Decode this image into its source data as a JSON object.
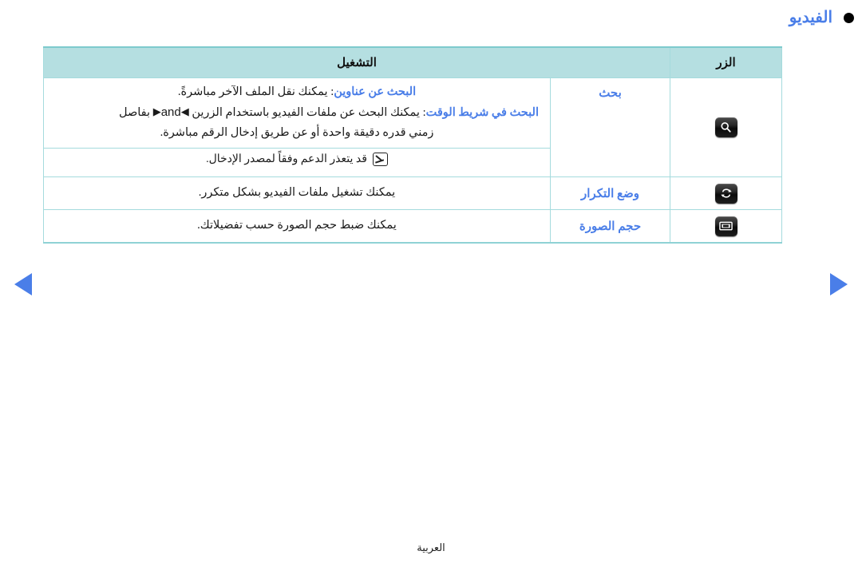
{
  "page": {
    "title": "الفيديو",
    "title_bullet_color": "#000000",
    "title_color": "#4a7ee8",
    "footer_label": "العربية",
    "language_direction": "rtl"
  },
  "navigation": {
    "prev_arrow": "◀",
    "next_arrow": "▶",
    "arrow_color": "#4a7ee8"
  },
  "table": {
    "header_bg": "#b5dfe1",
    "border_color": "#a5dbdd",
    "headers": {
      "operation": "التشغيل",
      "button": "الزر"
    },
    "rows": [
      {
        "button_icon": "search-icon",
        "label": "بحث",
        "lines": [
          {
            "term": "البحث عن عناوين",
            "text": ": يمكنك نقل الملف الآخر مباشرةً.",
            "align": "center"
          },
          {
            "term": "البحث في شريط الوقت",
            "text": ": يمكنك البحث عن ملفات الفيديو باستخدام الزرين ",
            "arrow_left": "◀",
            "mid_text": " and ",
            "arrow_right": "▶",
            "tail_text": " بفاصل",
            "align": "right"
          },
          {
            "text": "زمني قدره دقيقة واحدة أو عن طريق إدخال الرقم مباشرة.",
            "align": "center"
          }
        ],
        "note": {
          "icon": "note-pencil-icon",
          "text": "قد يتعذر الدعم وفقاً لمصدر الإدخال."
        }
      },
      {
        "button_icon": "repeat-icon",
        "label": "وضع التكرار",
        "lines": [
          {
            "text": "يمكنك تشغيل ملفات الفيديو بشكل متكرر.",
            "align": "center"
          }
        ]
      },
      {
        "button_icon": "picture-size-icon",
        "label": "حجم الصورة",
        "lines": [
          {
            "text": "يمكنك ضبط حجم الصورة حسب تفضيلاتك.",
            "align": "center"
          }
        ]
      }
    ]
  }
}
